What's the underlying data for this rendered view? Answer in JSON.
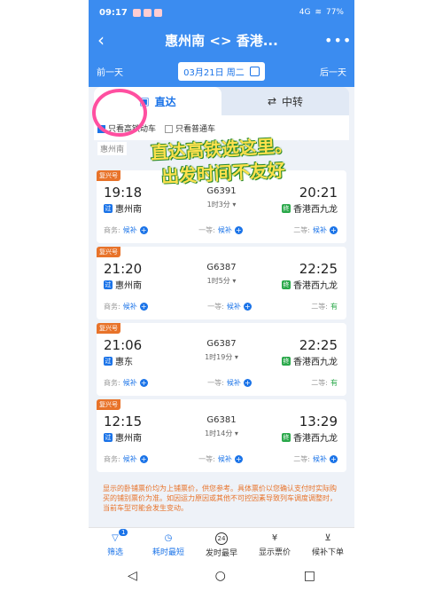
{
  "status": {
    "time": "09:17",
    "signal": "4G",
    "battery": "77%"
  },
  "header": {
    "title": "惠州南 <> 香港...",
    "back": "‹",
    "more": "•••"
  },
  "datebar": {
    "prev": "前一天",
    "date": "03月21日 周二",
    "next": "后一天"
  },
  "tabs": [
    {
      "label": "直达"
    },
    {
      "label": "中转"
    }
  ],
  "filters": {
    "gaotie": "只看高铁动车",
    "putong": "只看普通车"
  },
  "subtag": "惠州南",
  "overlay": {
    "line1": "直达高铁选这里。",
    "line2": "出发时间不友好"
  },
  "trains": [
    {
      "badge": "复兴号",
      "dep_time": "19:18",
      "train_no": "G6391",
      "duration": "1时3分 ▾",
      "arr_time": "20:21",
      "dep_tag": "过",
      "dep_station": "惠州南",
      "arr_tag": "终",
      "arr_station": "香港西九龙",
      "seat1": "商务:",
      "seat1_val": "候补",
      "seat2": "一等:",
      "seat2_val": "候补",
      "seat3": "二等:",
      "seat3_val": "候补"
    },
    {
      "badge": "复兴号",
      "dep_time": "21:20",
      "train_no": "G6387",
      "duration": "1时5分 ▾",
      "arr_time": "22:25",
      "dep_tag": "过",
      "dep_station": "惠州南",
      "arr_tag": "终",
      "arr_station": "香港西九龙",
      "seat1": "商务:",
      "seat1_val": "候补",
      "seat2": "一等:",
      "seat2_val": "候补",
      "seat3": "二等:",
      "seat3_val": "有"
    },
    {
      "badge": "复兴号",
      "dep_time": "21:06",
      "train_no": "G6387",
      "duration": "1时19分 ▾",
      "arr_time": "22:25",
      "dep_tag": "过",
      "dep_station": "惠东",
      "arr_tag": "终",
      "arr_station": "香港西九龙",
      "seat1": "商务:",
      "seat1_val": "候补",
      "seat2": "一等:",
      "seat2_val": "候补",
      "seat3": "二等:",
      "seat3_val": "有"
    },
    {
      "badge": "复兴号",
      "dep_time": "12:15",
      "train_no": "G6381",
      "duration": "1时14分 ▾",
      "arr_time": "13:29",
      "dep_tag": "过",
      "dep_station": "惠州南",
      "arr_tag": "终",
      "arr_station": "香港西九龙",
      "seat1": "商务:",
      "seat1_val": "候补",
      "seat2": "一等:",
      "seat2_val": "候补",
      "seat3": "二等:",
      "seat3_val": "候补"
    }
  ],
  "notice": "显示的卧铺票价均为上铺票价，供您参考。具体票价以您确认支付时实际购买的铺别票价为准。如因运力原因或其他不可控因素导致列车调度调整时，当前车型可能会发生变动。",
  "bottomnav": [
    {
      "label": "筛选",
      "badge": "1"
    },
    {
      "label": "耗时最短"
    },
    {
      "label": "发时最早",
      "icon": "24"
    },
    {
      "label": "显示票价"
    },
    {
      "label": "候补下单"
    }
  ],
  "colors": {
    "accent": "#3b8cf0",
    "link": "#1a73e8",
    "orange": "#e8732a"
  }
}
